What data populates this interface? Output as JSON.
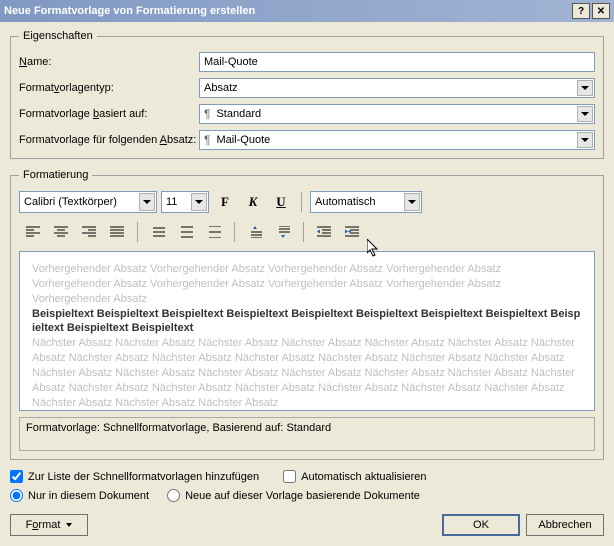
{
  "title": "Neue Formatvorlage von Formatierung erstellen",
  "groups": {
    "properties": "Eigenschaften",
    "formatting": "Formatierung"
  },
  "properties": {
    "name_label_pre": "",
    "name_u": "N",
    "name_label_post": "ame:",
    "name_value": "Mail-Quote",
    "type_label_pre": "Format",
    "type_u": "v",
    "type_label_post": "orlagentyp:",
    "type_value": "Absatz",
    "based_label_pre": "Formatvorlage ",
    "based_u": "b",
    "based_label_post": "asiert auf:",
    "based_value": "Standard",
    "follow_label_pre": "Formatvorlage für folgenden ",
    "follow_u": "A",
    "follow_label_post": "bsatz:",
    "follow_value": "Mail-Quote"
  },
  "format": {
    "font": "Calibri (Textkörper)",
    "size": "11",
    "bold": "F",
    "italic": "K",
    "underline": "U",
    "color": "Automatisch"
  },
  "preview": {
    "prev_para": "Vorhergehender Absatz Vorhergehender Absatz Vorhergehender Absatz Vorhergehender Absatz Vorhergehender Absatz Vorhergehender Absatz Vorhergehender Absatz Vorhergehender Absatz Vorhergehender Absatz",
    "sample": "Beispieltext Beispieltext Beispieltext Beispieltext Beispieltext Beispieltext Beispieltext Beispieltext Beispieltext Beispieltext Beispieltext",
    "next_para": "Nächster Absatz Nächster Absatz Nächster Absatz Nächster Absatz Nächster Absatz Nächster Absatz Nächster Absatz Nächster Absatz Nächster Absatz Nächster Absatz Nächster Absatz Nächster Absatz Nächster Absatz Nächster Absatz Nächster Absatz Nächster Absatz Nächster Absatz Nächster Absatz Nächster Absatz Nächster Absatz Nächster Absatz Nächster Absatz Nächster Absatz Nächster Absatz Nächster Absatz Nächster Absatz Nächster Absatz Nächster Absatz Nächster Absatz"
  },
  "status": "Formatvorlage: Schnellformatvorlage, Basierend auf: Standard",
  "options": {
    "quicklist": "Zur Liste der Schnellformatvorlagen hinzufügen",
    "autoupdate": "Automatisch aktualisieren",
    "thisdoc": "Nur in diesem Dokument",
    "newdocs": "Neue auf dieser Vorlage basierende Dokumente"
  },
  "buttons": {
    "format_pre": "F",
    "format_u": "o",
    "format_post": "rmat",
    "ok": "OK",
    "cancel": "Abbrechen"
  }
}
